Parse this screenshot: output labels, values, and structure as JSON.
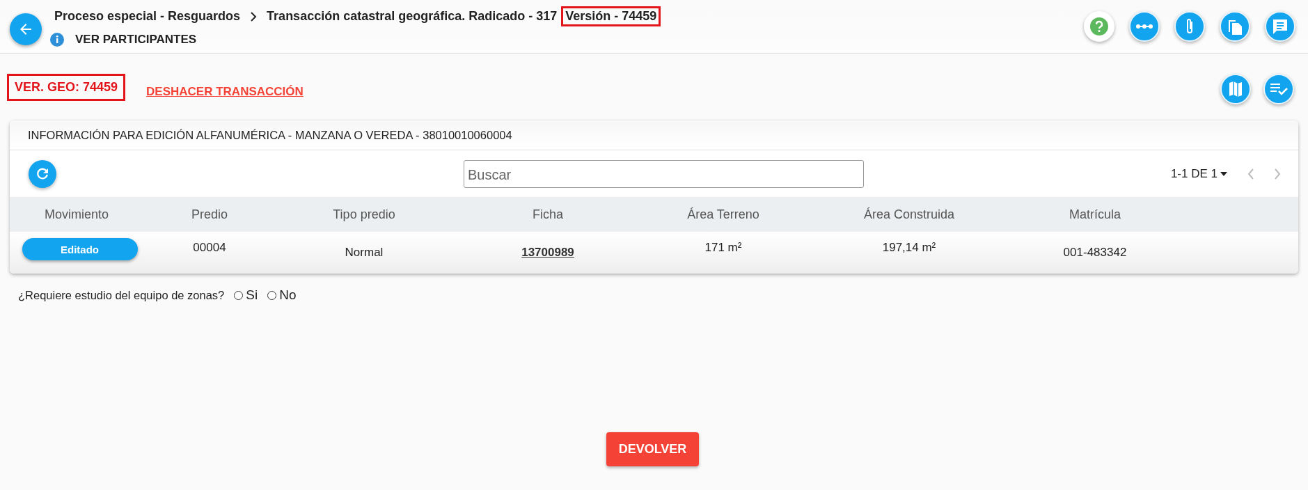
{
  "header": {
    "breadcrumb": [
      {
        "text": "Proceso especial - Resguardos",
        "highlighted": false
      },
      {
        "text": "Transacción catastral geográfica. Radicado - 317",
        "highlighted": false
      },
      {
        "text": "Versión - 74459",
        "highlighted": true
      }
    ],
    "participants_link": "VER PARTICIPANTES",
    "actions": [
      {
        "kind": "help"
      },
      {
        "kind": "flow"
      },
      {
        "kind": "attach"
      },
      {
        "kind": "copy"
      },
      {
        "kind": "comments"
      }
    ]
  },
  "version_geo": {
    "text": "VER. GEO: 74459",
    "highlighted": true
  },
  "undo_link": "DESHACER TRANSACCIÓN",
  "side_actions": [
    {
      "kind": "map"
    },
    {
      "kind": "checklist"
    }
  ],
  "card": {
    "title": "INFORMACIÓN PARA EDICIÓN ALFANUMÉRICA - MANZANA O VEREDA - 38010010060004",
    "search": {
      "placeholder": "Buscar"
    },
    "pagination": "1-1 DE 1",
    "table": {
      "columns": [
        "Movimiento",
        "Predio",
        "Tipo predio",
        "Ficha",
        "Área Terreno",
        "Área Construida",
        "Matrícula"
      ],
      "rows": [
        {
          "movimiento": "Editado",
          "predio": "00004",
          "tipo_predio": "Normal",
          "ficha": "13700989",
          "area_terreno": "171 m²",
          "area_construida": "197,14 m²",
          "matricula": "001-483342"
        }
      ]
    }
  },
  "question": {
    "text": "¿Requiere estudio del equipo de zonas?",
    "options": [
      {
        "label": "Si",
        "selected": false
      },
      {
        "label": "No",
        "selected": false
      }
    ]
  },
  "footer_button": "DEVOLVER"
}
